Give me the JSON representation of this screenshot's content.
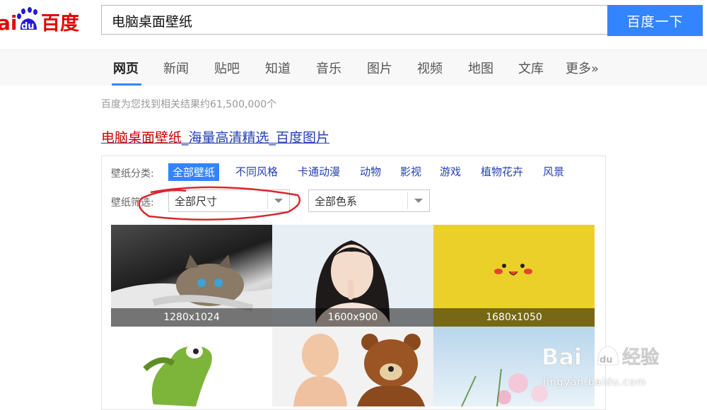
{
  "search": {
    "query": "电脑桌面壁纸",
    "button_label": "百度一下"
  },
  "logo": {
    "text_ai": "ai",
    "text_du": "du",
    "text_cn": "百度"
  },
  "nav": {
    "items": [
      "网页",
      "新闻",
      "贴吧",
      "知道",
      "音乐",
      "图片",
      "视频",
      "地图",
      "文库",
      "更多»"
    ],
    "active": "网页"
  },
  "results": {
    "count_text": "百度为您找到相关结果约61,500,000个",
    "title_em": "电脑桌面壁纸",
    "title_rest": "_海量高清精选_百度图片"
  },
  "wallpaper": {
    "category_label": "壁纸分类:",
    "categories": [
      "全部壁纸",
      "不同风格",
      "卡通动漫",
      "动物",
      "影视",
      "游戏",
      "植物花卉",
      "风景"
    ],
    "filter_label": "壁纸筛选:",
    "size_filter": "全部尺寸",
    "color_filter": "全部色系",
    "thumbnails": [
      {
        "size": "1280x1024",
        "subject": "kitten"
      },
      {
        "size": "1600x900",
        "subject": "girl"
      },
      {
        "size": "1680x1050",
        "subject": "pikachu-face"
      },
      {
        "size": "",
        "subject": "green-crocodile"
      },
      {
        "size": "",
        "subject": "baby-with-teddy-bear"
      },
      {
        "size": "",
        "subject": "flowers-sky"
      }
    ]
  },
  "watermark": {
    "brand": "Bai",
    "brand_du": "du",
    "cn": "经验",
    "url": "jingyan.baidu.com"
  },
  "colors": {
    "accent": "#3385ff",
    "link": "#2440b3",
    "em": "#cc0000",
    "annotation": "#d9272e"
  }
}
